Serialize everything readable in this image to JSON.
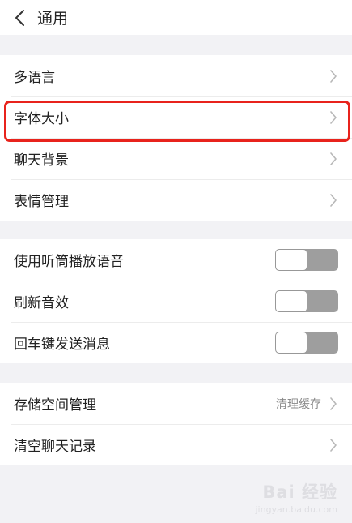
{
  "header": {
    "title": "通用",
    "back_icon": "chevron-left-icon"
  },
  "group1": {
    "items": [
      {
        "label": "多语言"
      },
      {
        "label": "字体大小"
      },
      {
        "label": "聊天背景"
      },
      {
        "label": "表情管理"
      }
    ]
  },
  "group2": {
    "items": [
      {
        "label": "使用听筒播放语音",
        "toggle_on": false
      },
      {
        "label": "刷新音效",
        "toggle_on": false
      },
      {
        "label": "回车键发送消息",
        "toggle_on": false
      }
    ]
  },
  "group3": {
    "items": [
      {
        "label": "存储空间管理",
        "value": "清理缓存"
      },
      {
        "label": "清空聊天记录"
      }
    ]
  },
  "watermark": {
    "main": "Bai 经验",
    "sub": "jingyan.baidu.com"
  },
  "colors": {
    "highlight": "#e8231c",
    "toggle_track": "#9e9e9e",
    "background": "#f2f2f5"
  }
}
